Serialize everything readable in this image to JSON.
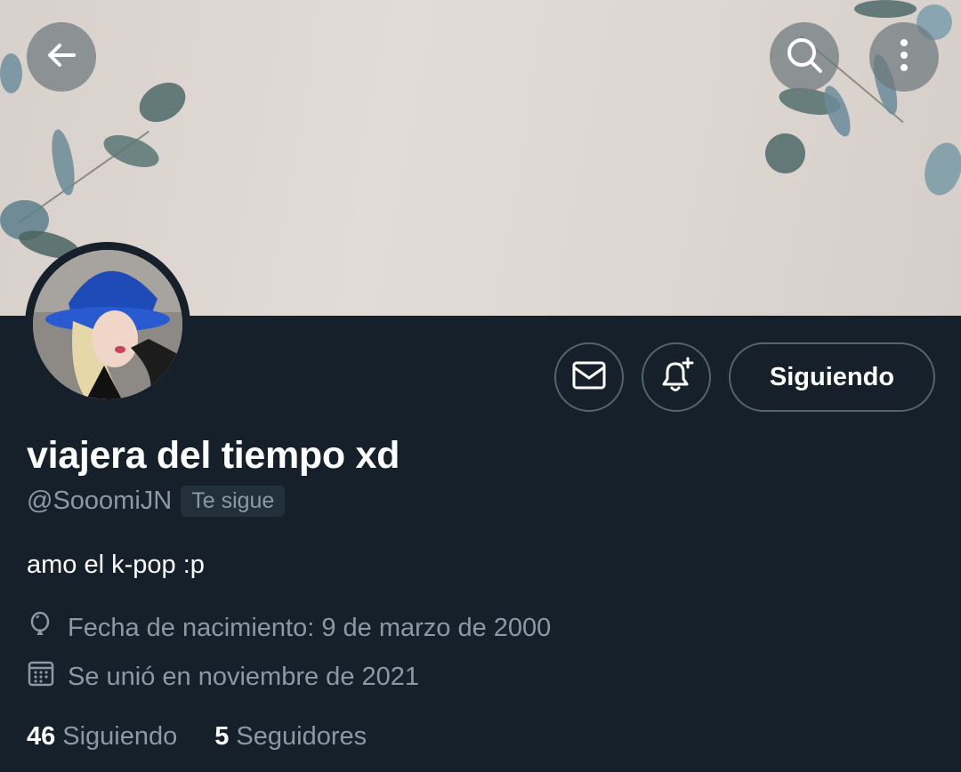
{
  "profile": {
    "display_name": "viajera del tiempo xd",
    "handle": "@SooomiJN",
    "follows_you_badge": "Te sigue",
    "bio": "amo el k-pop :p",
    "birthday": "Fecha de nacimiento: 9 de marzo de 2000",
    "joined": "Se unió en noviembre de 2021"
  },
  "actions": {
    "following_button": "Siguiendo"
  },
  "stats": {
    "following_count": "46",
    "following_label": "Siguiendo",
    "followers_count": "5",
    "followers_label": "Seguidores"
  },
  "icons": {
    "back": "back-arrow-icon",
    "search": "search-icon",
    "more": "more-vertical-icon",
    "message": "envelope-icon",
    "notify": "bell-plus-icon",
    "birthday": "balloon-icon",
    "joined": "calendar-icon"
  },
  "colors": {
    "background": "#15202b",
    "secondary_text": "#8b98a5",
    "border": "#536471"
  }
}
